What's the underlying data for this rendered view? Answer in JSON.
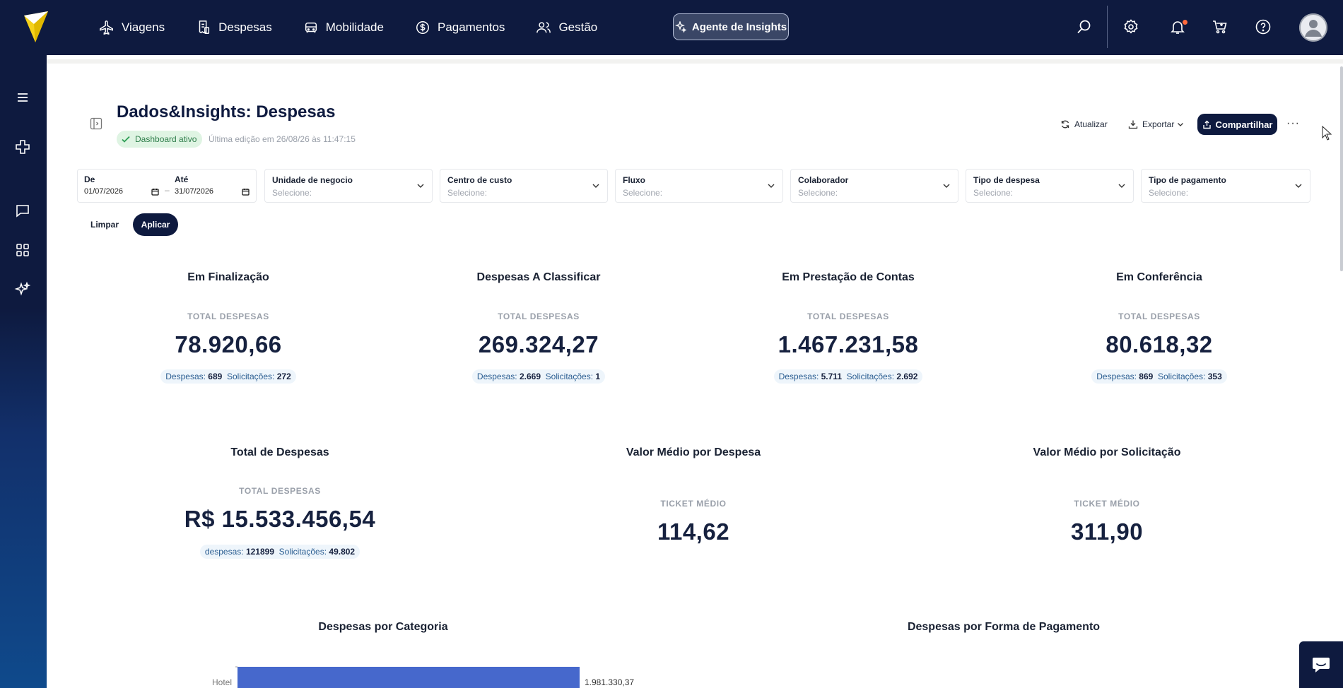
{
  "nav": {
    "items": [
      {
        "label": "Viagens",
        "icon": "plane-icon"
      },
      {
        "label": "Despesas",
        "icon": "receipt-icon"
      },
      {
        "label": "Mobilidade",
        "icon": "car-icon"
      },
      {
        "label": "Pagamentos",
        "icon": "dollar-coin-icon"
      },
      {
        "label": "Gestão",
        "icon": "users-icon"
      }
    ],
    "insights_label": "Agente de Insights"
  },
  "header": {
    "title": "Dados&Insights: Despesas",
    "status": "Dashboard ativo",
    "last_edit": "Última edição em 26/08/26 às 11:47:15",
    "actions": {
      "refresh": "Atualizar",
      "export": "Exportar",
      "share": "Compartilhar",
      "more": "···"
    }
  },
  "filters": {
    "from": {
      "label": "De",
      "value": "01/07/2026"
    },
    "to": {
      "label": "Até",
      "value": "31/07/2026"
    },
    "selects": [
      {
        "label": "Unidade de negocio",
        "placeholder": "Selecione:"
      },
      {
        "label": "Centro de custo",
        "placeholder": "Selecione:"
      },
      {
        "label": "Fluxo",
        "placeholder": "Selecione:"
      },
      {
        "label": "Colaborador",
        "placeholder": "Selecione:"
      },
      {
        "label": "Tipo de despesa",
        "placeholder": "Selecione:"
      },
      {
        "label": "Tipo de pagamento",
        "placeholder": "Selecione:"
      }
    ],
    "clear_label": "Limpar",
    "apply_label": "Aplicar"
  },
  "kpis_row1": [
    {
      "title": "Em Finalização",
      "sub": "TOTAL DESPESAS",
      "value": "78.920,66",
      "desp_label": "Despesas:",
      "desp": "689",
      "sol_label": "Solicitações:",
      "sol": "272"
    },
    {
      "title": "Despesas A Classificar",
      "sub": "TOTAL DESPESAS",
      "value": "269.324,27",
      "desp_label": "Despesas:",
      "desp": "2.669",
      "sol_label": "Solicitações:",
      "sol": "1"
    },
    {
      "title": "Em Prestação de Contas",
      "sub": "TOTAL DESPESAS",
      "value": "1.467.231,58",
      "desp_label": "Despesas:",
      "desp": "5.711",
      "sol_label": "Solicitações:",
      "sol": "2.692"
    },
    {
      "title": "Em Conferência",
      "sub": "TOTAL DESPESAS",
      "value": "80.618,32",
      "desp_label": "Despesas:",
      "desp": "869",
      "sol_label": "Solicitações:",
      "sol": "353"
    }
  ],
  "kpis_row2": [
    {
      "title": "Total de Despesas",
      "sub": "TOTAL DESPESAS",
      "value": "R$ 15.533.456,54",
      "desp_label": "despesas:",
      "desp": "121899",
      "sol_label": "Solicitações:",
      "sol": "49.802"
    },
    {
      "title": "Valor Médio por Despesa",
      "sub": "TICKET MÉDIO",
      "value": "114,62"
    },
    {
      "title": "Valor Médio por Solicitação",
      "sub": "TICKET MÉDIO",
      "value": "311,90"
    }
  ],
  "charts": {
    "category_title": "Despesas por Categoria",
    "payment_title": "Despesas por Forma de Pagamento"
  },
  "chart_data": {
    "type": "bar",
    "title": "Despesas por Categoria",
    "orientation": "horizontal",
    "categories": [
      "Hotel"
    ],
    "values": [
      1981330.37
    ],
    "value_labels": [
      "1.981.330,37"
    ]
  },
  "colors": {
    "navy": "#0e1a3f",
    "bar": "#4668cc",
    "success_bg": "#dff4e3",
    "notif": "#ff6a3d"
  }
}
